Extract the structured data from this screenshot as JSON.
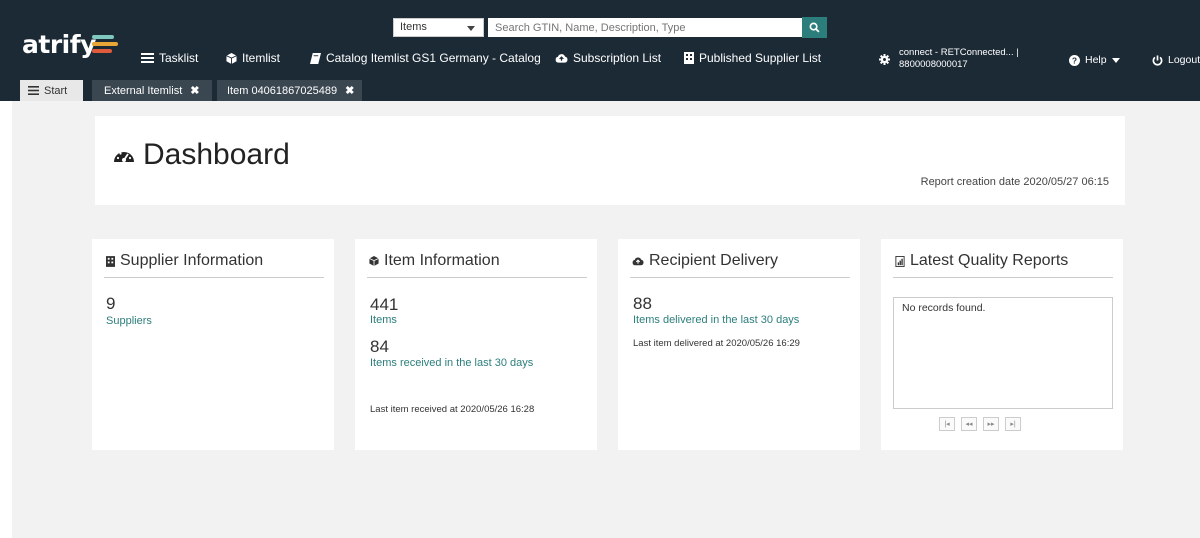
{
  "app": {
    "logo_text": "atrify"
  },
  "colors": {
    "topbar": "#1c2a36",
    "accent": "#2b7e7b",
    "logo_bar_1": "#7ec8c0",
    "logo_bar_2": "#e7a636",
    "logo_bar_3": "#e05a3c"
  },
  "search": {
    "type_selected": "Items",
    "placeholder": "Search GTIN, Name, Description, Type",
    "button_icon": "search-icon"
  },
  "nav": {
    "tasklist": "Tasklist",
    "itemlist": "Itemlist",
    "catalog": "Catalog Itemlist GS1 Germany - Catalog",
    "subscription": "Subscription List",
    "published": "Published Supplier List",
    "connect_line1": "connect - RETConnected... |",
    "connect_line2": "8800008000017",
    "help": "Help",
    "logout": "Logout"
  },
  "tabs": {
    "start": "Start",
    "external": "External Itemlist",
    "item": "Item 04061867025489",
    "close_glyph": "✖"
  },
  "dashboard": {
    "title": "Dashboard",
    "report_date": "Report creation date 2020/05/27 06:15"
  },
  "cards": {
    "supplier": {
      "title": "Supplier Information",
      "count": "9",
      "count_label": "Suppliers"
    },
    "item": {
      "title": "Item Information",
      "count": "441",
      "count_label": "Items",
      "received": "84",
      "received_label": "Items received in the last 30 days",
      "last_received": "Last item received at 2020/05/26 16:28"
    },
    "recipient": {
      "title": "Recipient Delivery",
      "count": "88",
      "count_label": "Items delivered in the last 30 days",
      "last_delivered": "Last item delivered at 2020/05/26 16:29"
    },
    "quality": {
      "title": "Latest Quality Reports",
      "empty": "No records found.",
      "pager": {
        "first": "|◂",
        "prev": "◂◂",
        "next": "▸▸",
        "last": "▸|"
      }
    }
  }
}
